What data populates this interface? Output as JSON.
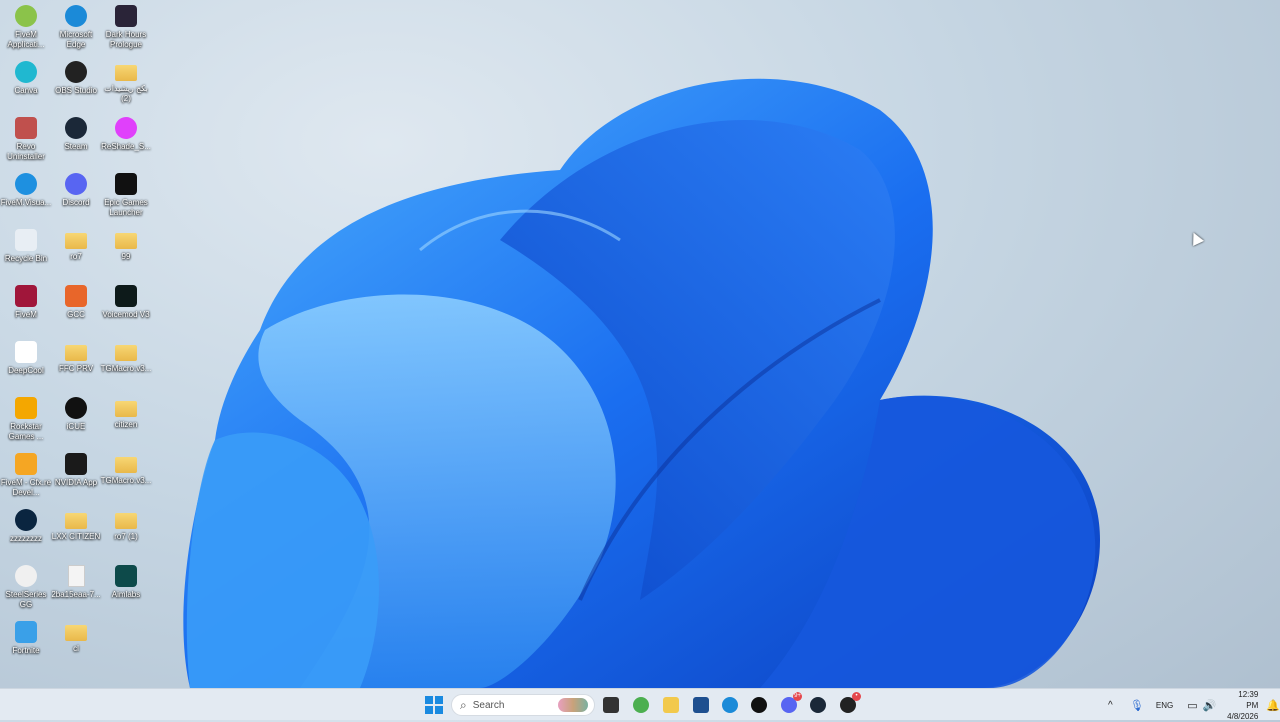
{
  "desktop": {
    "icons": [
      {
        "label": "FiveM Applicati...",
        "color": "#8bc34a",
        "kind": "circle",
        "col": 0,
        "row": 0
      },
      {
        "label": "Microsoft Edge",
        "color": "#1b8ad8",
        "kind": "circle",
        "col": 1,
        "row": 0
      },
      {
        "label": "Dark Hours Prologue",
        "color": "#2a2438",
        "kind": "box",
        "col": 2,
        "row": 0
      },
      {
        "label": "Canva",
        "color": "#20b8d0",
        "kind": "circle",
        "col": 0,
        "row": 1
      },
      {
        "label": "OBS Studio",
        "color": "#222",
        "kind": "circle",
        "col": 1,
        "row": 1
      },
      {
        "label": "بكج ريشيدات (2)",
        "color": "",
        "kind": "folder",
        "col": 2,
        "row": 1
      },
      {
        "label": "Revo Uninstaller",
        "color": "#c0504d",
        "kind": "box",
        "col": 0,
        "row": 2
      },
      {
        "label": "Steam",
        "color": "#1b2838",
        "kind": "circle",
        "col": 1,
        "row": 2
      },
      {
        "label": "ReShade_S...",
        "color": "#e040fb",
        "kind": "circle",
        "col": 2,
        "row": 2
      },
      {
        "label": "FiveM.Visua...",
        "color": "#1e90e0",
        "kind": "circle",
        "col": 0,
        "row": 3
      },
      {
        "label": "Discord",
        "color": "#5865f2",
        "kind": "circle",
        "col": 1,
        "row": 3
      },
      {
        "label": "Epic Games Launcher",
        "color": "#111",
        "kind": "box",
        "col": 2,
        "row": 3
      },
      {
        "label": "Recycle Bin",
        "color": "#e8eef4",
        "kind": "box",
        "col": 0,
        "row": 4
      },
      {
        "label": "ro7",
        "color": "",
        "kind": "folder",
        "col": 1,
        "row": 4
      },
      {
        "label": "99",
        "color": "",
        "kind": "folder",
        "col": 2,
        "row": 4
      },
      {
        "label": "FiveM",
        "color": "#a0163a",
        "kind": "box",
        "col": 0,
        "row": 5
      },
      {
        "label": "GCC",
        "color": "#e8662a",
        "kind": "box",
        "col": 1,
        "row": 5
      },
      {
        "label": "Voicemod V3",
        "color": "#0d1a1a",
        "kind": "box",
        "col": 2,
        "row": 5
      },
      {
        "label": "DeepCool",
        "color": "#ffffff",
        "kind": "box",
        "col": 0,
        "row": 6
      },
      {
        "label": "FFC PRV",
        "color": "",
        "kind": "folder",
        "col": 1,
        "row": 6
      },
      {
        "label": "TGMacro.v3...",
        "color": "",
        "kind": "folder",
        "col": 2,
        "row": 6
      },
      {
        "label": "Rockstar Games ...",
        "color": "#f4a700",
        "kind": "box",
        "col": 0,
        "row": 7
      },
      {
        "label": "iCUE",
        "color": "#111",
        "kind": "circle",
        "col": 1,
        "row": 7
      },
      {
        "label": "citizen",
        "color": "",
        "kind": "folder",
        "col": 2,
        "row": 7
      },
      {
        "label": "FiveM - Cfx.re Devel...",
        "color": "#f5a623",
        "kind": "box",
        "col": 0,
        "row": 8
      },
      {
        "label": "NVIDIA App",
        "color": "#1a1a1a",
        "kind": "box",
        "col": 1,
        "row": 8
      },
      {
        "label": "TGMacro.v3...",
        "color": "",
        "kind": "folder",
        "col": 2,
        "row": 8
      },
      {
        "label": "zzzzzzzz",
        "color": "#0a2540",
        "kind": "circle",
        "col": 0,
        "row": 9
      },
      {
        "label": "LXX CITIZEN",
        "color": "",
        "kind": "folder",
        "col": 1,
        "row": 9
      },
      {
        "label": "ro7 (1)",
        "color": "",
        "kind": "folder",
        "col": 2,
        "row": 9
      },
      {
        "label": "SteelSeries GG",
        "color": "#f0f0f0",
        "kind": "circle",
        "col": 0,
        "row": 10
      },
      {
        "label": "2ba15eaa-7...",
        "color": "",
        "kind": "file",
        "col": 1,
        "row": 10
      },
      {
        "label": "Aimlabs",
        "color": "#0d4a4a",
        "kind": "box",
        "col": 2,
        "row": 10
      },
      {
        "label": "Fortnite",
        "color": "#3aa0e8",
        "kind": "box",
        "col": 0,
        "row": 11
      },
      {
        "label": "cl",
        "color": "",
        "kind": "folder",
        "col": 1,
        "row": 11
      }
    ]
  },
  "taskbar": {
    "search_placeholder": "Search",
    "apps": [
      {
        "name": "start",
        "color": "#1a8ae0"
      },
      {
        "name": "task-view",
        "color": "#333"
      },
      {
        "name": "chrome",
        "color": "#4caf50"
      },
      {
        "name": "file-explorer",
        "color": "#f2c94c"
      },
      {
        "name": "microsoft-store",
        "color": "#1e4f8f"
      },
      {
        "name": "edge",
        "color": "#1b8ad8"
      },
      {
        "name": "tiktok",
        "color": "#111"
      },
      {
        "name": "discord",
        "color": "#5865f2",
        "badge": "9+"
      },
      {
        "name": "steam",
        "color": "#1b2838"
      },
      {
        "name": "obs",
        "color": "#222",
        "badge": "•"
      }
    ],
    "tray": {
      "language": "ENG",
      "time": "12:39 PM",
      "date": "4/8/2026"
    }
  }
}
